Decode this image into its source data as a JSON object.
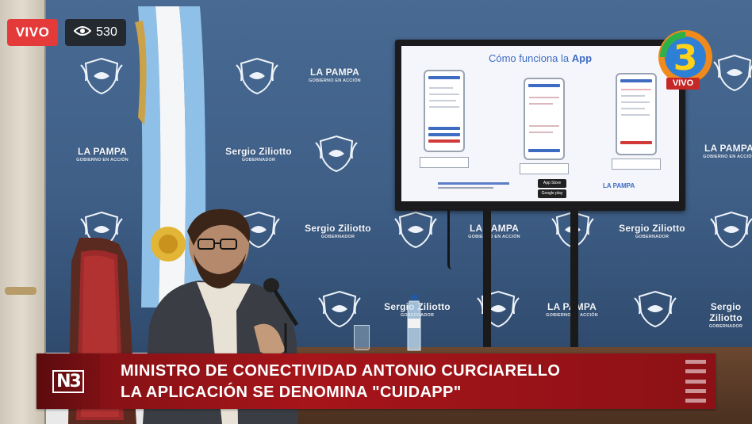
{
  "overlay": {
    "live_label": "VIVO",
    "viewer_count": "530",
    "viewer_icon": "eye-icon"
  },
  "channel_logo": {
    "number": "3",
    "live_label": "VIVO"
  },
  "backdrop": {
    "logo_name": "LA PAMPA",
    "logo_sub": "GOBIERNO EN ACCIÓN",
    "governor_name": "Sergio Ziliotto",
    "governor_sub": "GOBERNADOR"
  },
  "tv": {
    "title_prefix": "Cómo funciona la ",
    "title_bold": "App",
    "store_1": "App Store",
    "store_2": "Google play",
    "brand": "LA PAMPA"
  },
  "lower_third": {
    "network_logo": "N3",
    "line1": "MINISTRO DE CONECTIVIDAD ANTONIO CURCIARELLO",
    "line2": "LA APLICACIÓN SE DENOMINA \"CUIDAPP\"",
    "menu_icon": "hamburger-icon"
  }
}
